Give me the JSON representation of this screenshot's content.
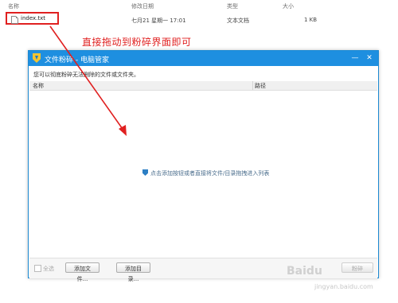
{
  "explorer": {
    "columns": {
      "name": "名称",
      "modified": "修改日期",
      "type": "类型",
      "size": "大小"
    },
    "file": {
      "name": "index.txt",
      "modified": "七月21 星期一 17:01",
      "type": "文本文档",
      "size": "1 KB"
    }
  },
  "annotation": "直接拖动到粉碎界面即可",
  "dialog": {
    "title": "文件粉碎 - 电脑管家",
    "hint": "您可以彻底粉碎无法删除的文件或文件夹。",
    "list_header": {
      "name": "名称",
      "path": "路径"
    },
    "empty_hint": "点击添加按钮或者直接将文件/目录拖拽进入列表",
    "select_all": "全选",
    "add_file": "添加文件...",
    "add_folder": "添加目录...",
    "shred": "粉碎"
  },
  "watermark": {
    "brand": "Baidu",
    "sub": "jingyan.baidu.com"
  },
  "colors": {
    "titlebar": "#1e8fe0",
    "annotation": "#e02020"
  }
}
